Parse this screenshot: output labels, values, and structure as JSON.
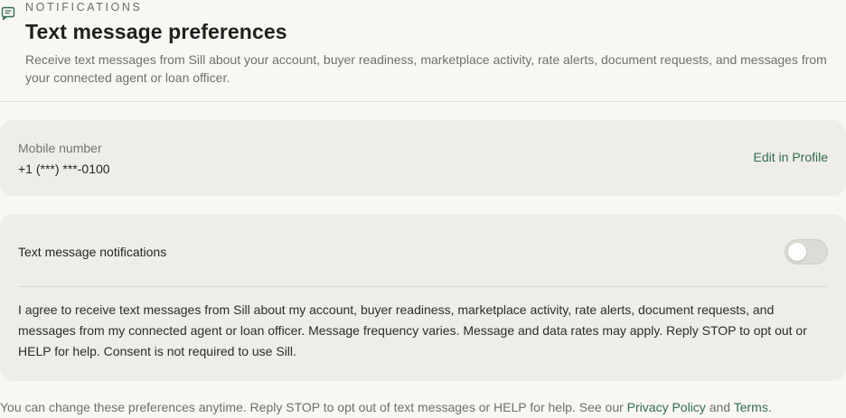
{
  "header": {
    "icon": "message-square-icon",
    "eyebrow": "NOTIFICATIONS",
    "title": "Text message preferences",
    "subtitle": "Receive text messages from Sill about your account, buyer readiness, marketplace activity, rate alerts, document requests, and messages from your connected agent or loan officer."
  },
  "mobile": {
    "label": "Mobile number",
    "value": "+1 (***) ***-0100",
    "edit_label": "Edit in Profile"
  },
  "sms": {
    "toggle_label": "Text message notifications",
    "toggle_on": false,
    "consent": "I agree to receive text messages from Sill about my account, buyer readiness, marketplace activity, rate alerts, document requests, and messages from my connected agent or loan officer. Message frequency varies. Message and data rates may apply. Reply STOP to opt out or HELP for help. Consent is not required to use Sill."
  },
  "footer": {
    "text": "You can change these preferences anytime. Reply STOP to opt out of text messages or HELP for help. See our",
    "privacy_label": "Privacy Policy",
    "and": "and",
    "terms_label": "Terms",
    "end": "."
  },
  "colors": {
    "accent": "#2f6e4a",
    "background": "#f8f7f4",
    "card": "#eeede9"
  }
}
